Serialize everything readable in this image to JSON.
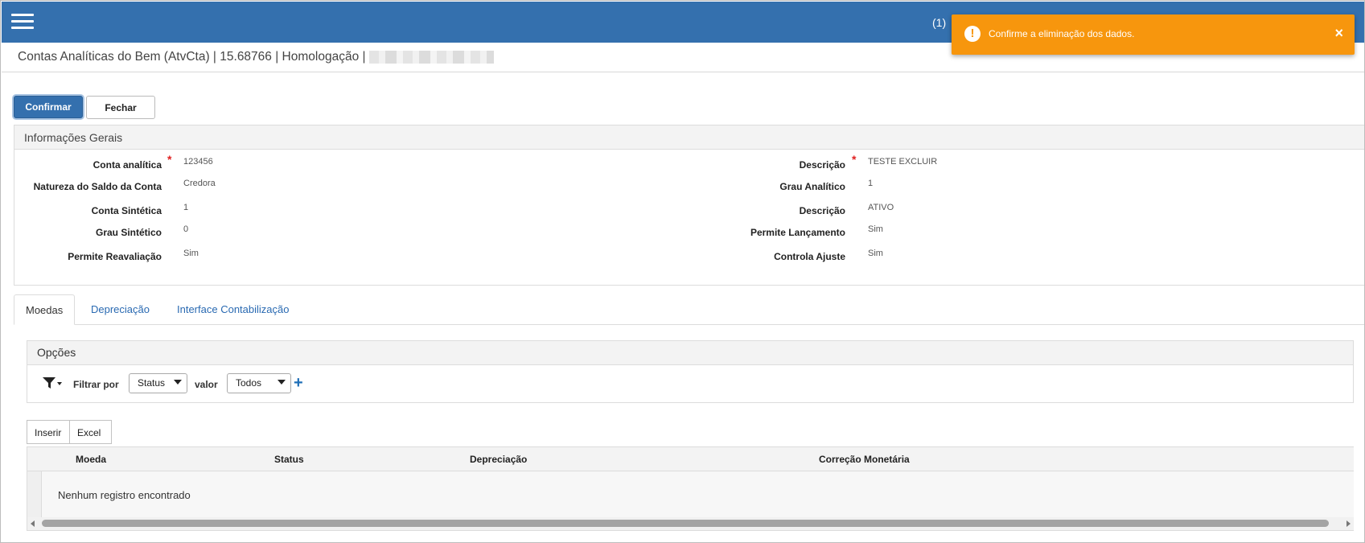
{
  "header": {
    "notification_count": "(1)",
    "menu_icon": "hamburger-icon"
  },
  "toast": {
    "icon": "alert-circle-icon",
    "message": "Confirme a eliminação dos dados.",
    "close_label": "×",
    "color": "#f7960d"
  },
  "page": {
    "title": "Contas Analíticas do Bem (AtvCta) | 15.68766 | Homologação |"
  },
  "actions": {
    "confirm_label": "Confirmar",
    "close_label": "Fechar"
  },
  "general_info": {
    "heading": "Informações Gerais",
    "left": [
      {
        "label": "Conta analítica",
        "value": "123456",
        "required": "*"
      },
      {
        "label": "Natureza do Saldo da Conta",
        "value": "Credora"
      },
      {
        "label": "Conta Sintética",
        "value": "1"
      },
      {
        "label": "Grau Sintético",
        "value": "0"
      },
      {
        "label": "Permite Reavaliação",
        "value": "Sim"
      }
    ],
    "right": [
      {
        "label": "Descrição",
        "value": "TESTE EXCLUIR",
        "required": "*"
      },
      {
        "label": "Grau Analítico",
        "value": "1"
      },
      {
        "label": "Descrição",
        "value": "ATIVO"
      },
      {
        "label": "Permite Lançamento",
        "value": "Sim"
      },
      {
        "label": "Controla Ajuste",
        "value": "Sim"
      }
    ]
  },
  "tabs": [
    {
      "label": "Moedas",
      "active": true
    },
    {
      "label": "Depreciação",
      "active": false
    },
    {
      "label": "Interface Contabilização",
      "active": false
    }
  ],
  "options": {
    "heading": "Opções",
    "filter_icon": "filter-icon",
    "filter_by_label": "Filtrar por",
    "filter_by_value": "Status",
    "value_label": "valor",
    "value_value": "Todos",
    "add_label": "+"
  },
  "grid": {
    "insert_label": "Inserir",
    "excel_label": "Excel",
    "columns": [
      "Moeda",
      "Status",
      "Depreciação",
      "Correção Monetária"
    ],
    "empty_message": "Nenhum registro encontrado"
  },
  "colors": {
    "primary": "#3470ae",
    "link": "#2a6ab2",
    "required": "#e02020"
  }
}
